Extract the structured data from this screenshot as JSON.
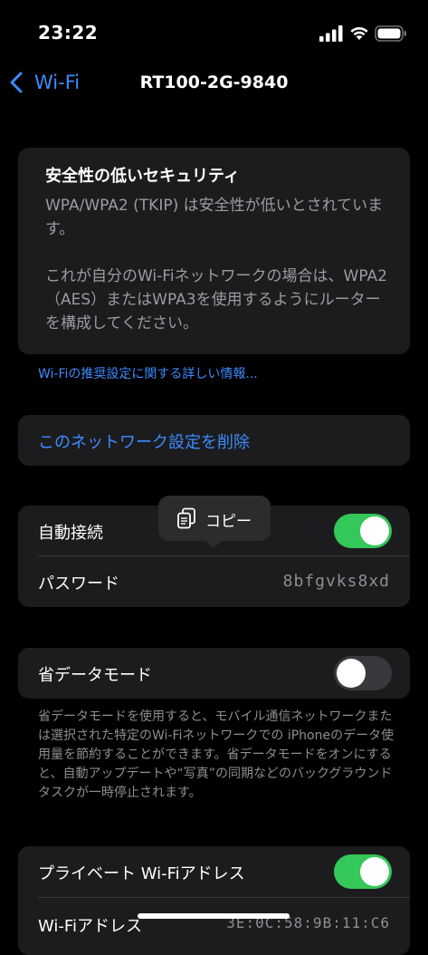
{
  "status_bar": {
    "time": "23:22"
  },
  "nav": {
    "back_label": "Wi-Fi",
    "title": "RT100-2G-9840"
  },
  "warning": {
    "title": "安全性の低いセキュリティ",
    "line1": "WPA/WPA2 (TKIP) は安全性が低いとされています。",
    "line2": "これが自分のWi-Fiネットワークの場合は、WPA2（AES）またはWPA3を使用するようにルーターを構成してください。"
  },
  "more_info_link": "Wi-Fiの推奨設定に関する詳しい情報...",
  "forget_network": "このネットワーク設定を削除",
  "auto_join": {
    "label": "自動接続",
    "on": true
  },
  "password": {
    "label": "パスワード",
    "value": "8bfgvks8xd"
  },
  "copy_popup": {
    "label": "コピー"
  },
  "low_data": {
    "label": "省データモード",
    "on": false,
    "description": "省データモードを使用すると、モバイル通信ネットワークまたは選択された特定のWi-Fiネットワークでの iPhoneのデータ使用量を節約することができます。省データモードをオンにすると、自動アップデートや“写真”の同期などのバックグラウンドタスクが一時停止されます。"
  },
  "private_address": {
    "label": "プライベート Wi-Fiアドレス",
    "on": true
  },
  "wifi_address": {
    "label": "Wi-Fiアドレス",
    "value": "3E:0C:58:9B:11:C6"
  },
  "colors": {
    "accent": "#3d8bff",
    "toggle_on": "#34c759",
    "card": "#1c1c1e"
  }
}
